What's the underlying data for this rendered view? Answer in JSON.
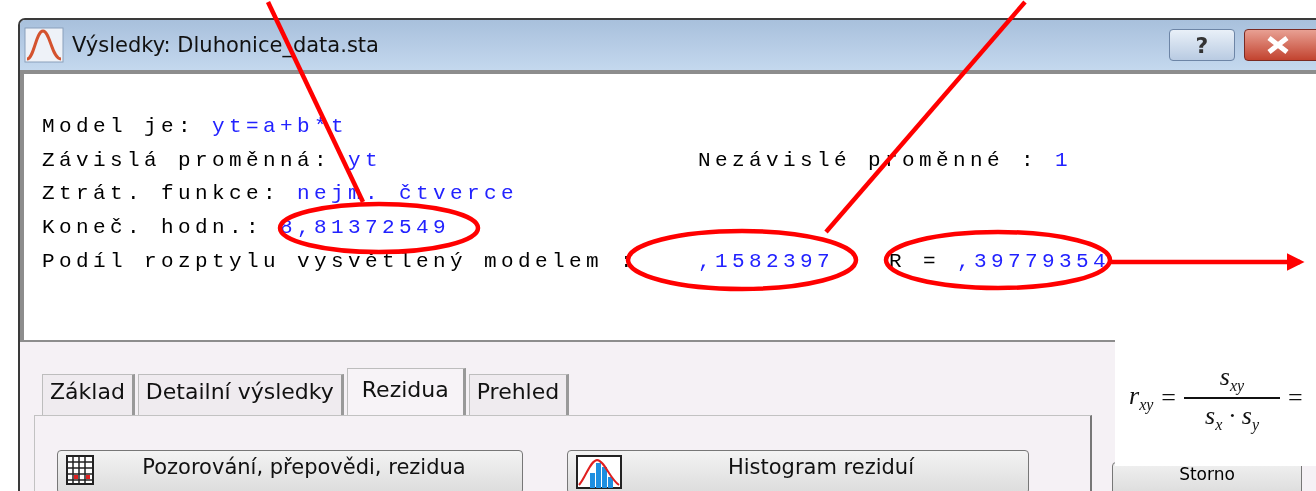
{
  "window": {
    "title": "Výsledky: Dluhonice_data.sta",
    "help_button": "?"
  },
  "results": {
    "lines": [
      {
        "segments": [
          {
            "label": "Model je:",
            "value": "yt=a+b*t"
          }
        ]
      },
      {
        "segments": [
          {
            "label": "Závislá proměnná:",
            "value": "yt"
          },
          {
            "label": "Nezávislé proměnné :",
            "value": "1"
          }
        ]
      },
      {
        "segments": [
          {
            "label": "Ztrát. funkce:",
            "value": "nejm. čtverce"
          }
        ]
      },
      {
        "segments": [
          {
            "label": "Koneč. hodn.:",
            "value": "8,81372549"
          }
        ]
      },
      {
        "segments": [
          {
            "label": "Podíl rozptylu vysvětlený modelem :"
          },
          {
            "value": ",1582397"
          },
          {
            "label": "R =",
            "value": ",39779354"
          }
        ]
      }
    ]
  },
  "tabs": [
    {
      "label": "Základ",
      "selected": false
    },
    {
      "label": "Detailní výsledky",
      "selected": false
    },
    {
      "label": "Rezidua",
      "selected": true
    },
    {
      "label": "Prehled",
      "selected": false
    }
  ],
  "buttons": [
    {
      "label": "Pozorování, přepovědi, rezidua",
      "kind": "table"
    },
    {
      "label": "Histogram reziduí",
      "kind": "histogram"
    }
  ],
  "side_button": "Storno",
  "formula": {
    "lhs": "r$_{xy}$",
    "equals": "=",
    "numerator": "s$_{xy}$",
    "denominator": "s$_{x}$ · s$_{y}$",
    "trailing": "="
  }
}
